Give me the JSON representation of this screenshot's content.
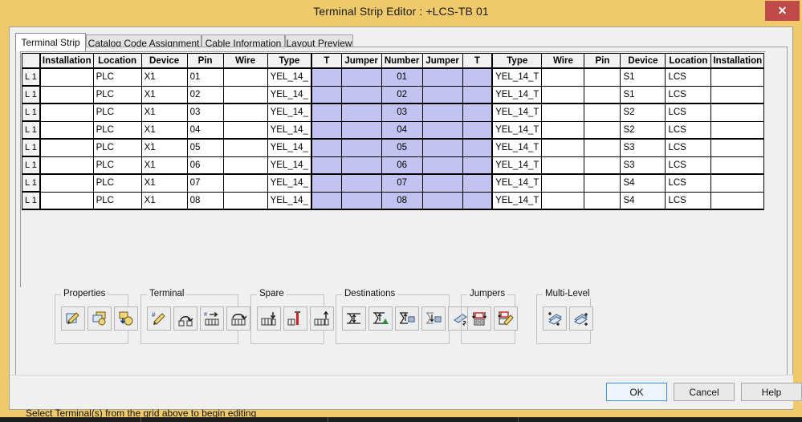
{
  "window": {
    "title": "Terminal Strip Editor : +LCS-TB 01",
    "close_label": "✕",
    "titlebar_color": "#efc96a",
    "close_color": "#c04a4a"
  },
  "tabs": [
    {
      "label": "Terminal Strip",
      "active": true
    },
    {
      "label": "Catalog Code Assignment",
      "active": false
    },
    {
      "label": "Cable Information",
      "active": false
    },
    {
      "label": "Layout Preview",
      "active": false
    }
  ],
  "grid": {
    "row_header_label": "",
    "columns": [
      "Installation",
      "Location",
      "Device",
      "Pin",
      "Wire",
      "Type",
      "T",
      "Jumper",
      "Number",
      "Jumper",
      "T",
      "Type",
      "Wire",
      "Pin",
      "Device",
      "Location",
      "Installation"
    ],
    "rows": [
      {
        "level": "L 1",
        "installation": "",
        "location": "PLC",
        "device": "X1",
        "pin": "01",
        "wire": "",
        "type": "YEL_14_",
        "t1": "",
        "jumper1": "",
        "number": "01",
        "jumper2": "",
        "t2": "",
        "type2": "YEL_14_T",
        "wire2": "",
        "pin2": "",
        "device2": "S1",
        "location2": "LCS",
        "installation2": ""
      },
      {
        "level": "L 1",
        "installation": "",
        "location": "PLC",
        "device": "X1",
        "pin": "02",
        "wire": "",
        "type": "YEL_14_",
        "t1": "",
        "jumper1": "",
        "number": "02",
        "jumper2": "",
        "t2": "",
        "type2": "YEL_14_T",
        "wire2": "",
        "pin2": "",
        "device2": "S1",
        "location2": "LCS",
        "installation2": ""
      },
      {
        "level": "L 1",
        "installation": "",
        "location": "PLC",
        "device": "X1",
        "pin": "03",
        "wire": "",
        "type": "YEL_14_",
        "t1": "",
        "jumper1": "",
        "number": "03",
        "jumper2": "",
        "t2": "",
        "type2": "YEL_14_T",
        "wire2": "",
        "pin2": "",
        "device2": "S2",
        "location2": "LCS",
        "installation2": ""
      },
      {
        "level": "L 1",
        "installation": "",
        "location": "PLC",
        "device": "X1",
        "pin": "04",
        "wire": "",
        "type": "YEL_14_",
        "t1": "",
        "jumper1": "",
        "number": "04",
        "jumper2": "",
        "t2": "",
        "type2": "YEL_14_T",
        "wire2": "",
        "pin2": "",
        "device2": "S2",
        "location2": "LCS",
        "installation2": ""
      },
      {
        "level": "L 1",
        "installation": "",
        "location": "PLC",
        "device": "X1",
        "pin": "05",
        "wire": "",
        "type": "YEL_14_",
        "t1": "",
        "jumper1": "",
        "number": "05",
        "jumper2": "",
        "t2": "",
        "type2": "YEL_14_T",
        "wire2": "",
        "pin2": "",
        "device2": "S3",
        "location2": "LCS",
        "installation2": ""
      },
      {
        "level": "L 1",
        "installation": "",
        "location": "PLC",
        "device": "X1",
        "pin": "06",
        "wire": "",
        "type": "YEL_14_",
        "t1": "",
        "jumper1": "",
        "number": "06",
        "jumper2": "",
        "t2": "",
        "type2": "YEL_14_T",
        "wire2": "",
        "pin2": "",
        "device2": "S3",
        "location2": "LCS",
        "installation2": ""
      },
      {
        "level": "L 1",
        "installation": "",
        "location": "PLC",
        "device": "X1",
        "pin": "07",
        "wire": "",
        "type": "YEL_14_",
        "t1": "",
        "jumper1": "",
        "number": "07",
        "jumper2": "",
        "t2": "",
        "type2": "YEL_14_T",
        "wire2": "",
        "pin2": "",
        "device2": "S4",
        "location2": "LCS",
        "installation2": ""
      },
      {
        "level": "L 1",
        "installation": "",
        "location": "PLC",
        "device": "X1",
        "pin": "08",
        "wire": "",
        "type": "YEL_14_",
        "t1": "",
        "jumper1": "",
        "number": "08",
        "jumper2": "",
        "t2": "",
        "type2": "YEL_14_T",
        "wire2": "",
        "pin2": "",
        "device2": "S4",
        "location2": "LCS",
        "installation2": ""
      }
    ],
    "highlight_color": "#c3c3f2"
  },
  "groups": [
    {
      "legend": "Properties",
      "buttons": [
        "edit-properties-icon",
        "copy-properties-icon",
        "assign-properties-icon"
      ]
    },
    {
      "legend": "Terminal",
      "buttons": [
        "renumber-terminal-icon",
        "insert-terminal-icon",
        "move-terminal-icon",
        "reorder-terminal-icon"
      ]
    },
    {
      "legend": "Spare",
      "buttons": [
        "insert-spare-icon",
        "delete-spare-icon",
        "add-spare-icon"
      ]
    },
    {
      "legend": "Destinations",
      "buttons": [
        "destination-icon",
        "add-destination-icon",
        "edit-destination-icon",
        "move-destination-icon",
        "swap-destination-icon"
      ]
    },
    {
      "legend": "Jumpers",
      "buttons": [
        "add-jumper-icon",
        "edit-jumper-icon"
      ]
    },
    {
      "legend": "Multi-Level",
      "buttons": [
        "add-level-icon",
        "remove-level-icon"
      ]
    }
  ],
  "status": {
    "message": "Select Terminal(s) from the grid above to begin editing"
  },
  "buttons": {
    "ok": "OK",
    "cancel": "Cancel",
    "help": "Help"
  }
}
